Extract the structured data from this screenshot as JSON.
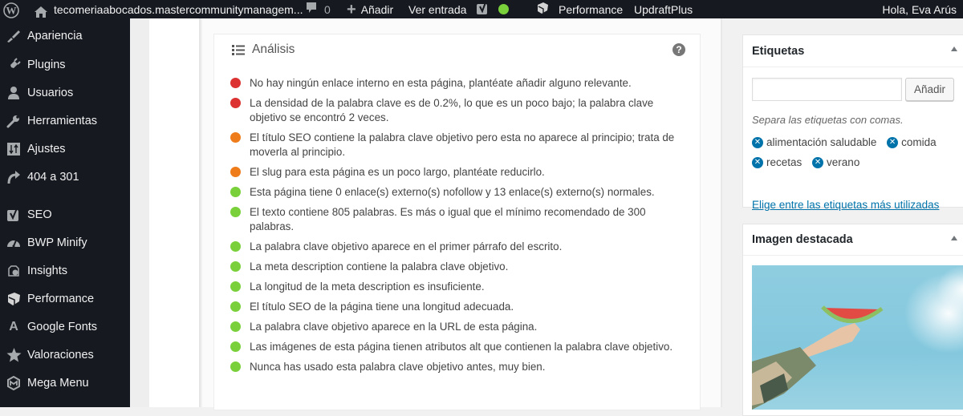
{
  "adminbar": {
    "site_name": "tecomeriaabocados.mastercommunitymanagem...",
    "comments_count": "0",
    "add_label": "Añadir",
    "view_label": "Ver entrada",
    "performance_label": "Performance",
    "updraft_label": "UpdraftPlus",
    "greeting": "Hola, Eva Arús",
    "seo_status_color": "#7ad03a"
  },
  "sidebar": {
    "items": [
      {
        "label": "Apariencia",
        "icon": "paintbrush-icon"
      },
      {
        "label": "Plugins",
        "icon": "plugin-icon"
      },
      {
        "label": "Usuarios",
        "icon": "user-icon"
      },
      {
        "label": "Herramientas",
        "icon": "wrench-icon"
      },
      {
        "label": "Ajustes",
        "icon": "settings-icon"
      },
      {
        "label": "404 a 301",
        "icon": "redirect-arrow-icon"
      },
      {
        "label": "SEO",
        "icon": "yoast-icon"
      },
      {
        "label": "BWP Minify",
        "icon": "dashboard-gauge-icon"
      },
      {
        "label": "Insights",
        "icon": "insights-icon"
      },
      {
        "label": "Performance",
        "icon": "performance-icon"
      },
      {
        "label": "Google Fonts",
        "icon": "font-a-icon"
      },
      {
        "label": "Valoraciones",
        "icon": "star-icon"
      },
      {
        "label": "Mega Menu",
        "icon": "mega-menu-icon"
      }
    ]
  },
  "analysis": {
    "title": "Análisis",
    "colors": {
      "bad": "#dc3232",
      "ok": "#ee7c1b",
      "good": "#7ad03a"
    },
    "results": [
      {
        "status": "bad",
        "text": "No hay ningún enlace interno en esta página, plantéate añadir alguno relevante."
      },
      {
        "status": "bad",
        "text": "La densidad de la palabra clave es de 0.2%, lo que es un poco bajo; la palabra clave objetivo se encontró 2 veces."
      },
      {
        "status": "ok",
        "text": "El título SEO contiene la palabra clave objetivo pero esta no aparece al principio; trata de moverla al principio."
      },
      {
        "status": "ok",
        "text": "El slug para esta página es un poco largo, plantéate reducirlo."
      },
      {
        "status": "good",
        "text": "Esta página tiene 0 enlace(s) externo(s) nofollow y 13 enlace(s) externo(s) normales."
      },
      {
        "status": "good",
        "text": "El texto contiene 805 palabras. Es más o igual que el mínimo recomendado de 300 palabras."
      },
      {
        "status": "good",
        "text": "La palabra clave objetivo aparece en el primer párrafo del escrito."
      },
      {
        "status": "good",
        "text": "La meta description contiene la palabra clave objetivo."
      },
      {
        "status": "good",
        "text": "La longitud de la meta description es insuficiente."
      },
      {
        "status": "good",
        "text": "El título SEO de la página tiene una longitud adecuada."
      },
      {
        "status": "good",
        "text": "La palabra clave objetivo aparece en la URL de esta página."
      },
      {
        "status": "good",
        "text": "Las imágenes de esta página tienen atributos alt que contienen la palabra clave objetivo."
      },
      {
        "status": "good",
        "text": "Nunca has usado esta palabra clave objetivo antes, muy bien."
      }
    ]
  },
  "tags_box": {
    "title": "Etiquetas",
    "input_value": "",
    "add_button": "Añadir",
    "hint": "Separa las etiquetas con comas.",
    "tags": [
      "alimentación saludable",
      "comida",
      "recetas",
      "verano"
    ],
    "most_used_link": "Elige entre las etiquetas más utilizadas"
  },
  "featured_box": {
    "title": "Imagen destacada",
    "image_alt": "Brazo sosteniendo una rodaja de sandía contra el cielo azul"
  }
}
